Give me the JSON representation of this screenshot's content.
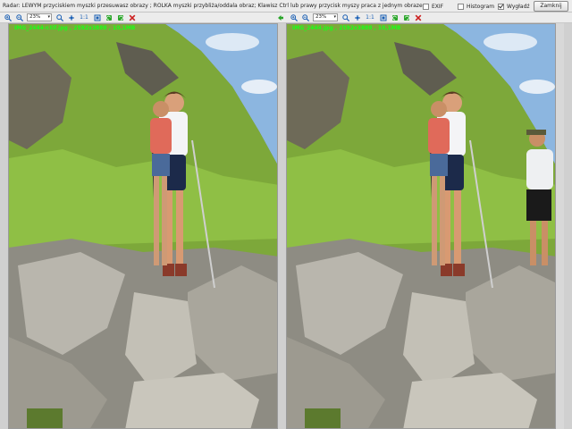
{
  "topbar": {
    "hint": "Radar: LEWYM przyciskiem myszki przesuwasz obrazy ; ROLKA myszki przybliża/oddala obraz; Klawisz Ctrl lub prawy przycisk myszy praca z jednym obrazem.",
    "exif_label": "EXIF",
    "exif_checked": false,
    "histogram_label": "Histogram",
    "histogram_checked": false,
    "smoothing_label": "Wygładź",
    "smoothing_checked": true,
    "close_label": "Zamknij"
  },
  "toolbar": {
    "zoom_value": "23%",
    "one_to_one_label": "1:1",
    "icons": [
      "zoom-in",
      "zoom-out",
      "zoom",
      "fit",
      "1:1",
      "fit-window",
      "rotate-left",
      "rotate-right",
      "delete"
    ]
  },
  "left_pane": {
    "file_info": "IMG_2444-r.tif.jpg , 2592x3888 , 10,1MB"
  },
  "right_pane": {
    "file_info": "IMG_2444.jpg , 2592x3888 , 10,1MB"
  },
  "colors": {
    "accent_icons": "#1a5fb4",
    "delete_icon": "#cc1f1f",
    "file_info_text": "#1aff1a",
    "arrow_icon": "#2aa52a"
  }
}
